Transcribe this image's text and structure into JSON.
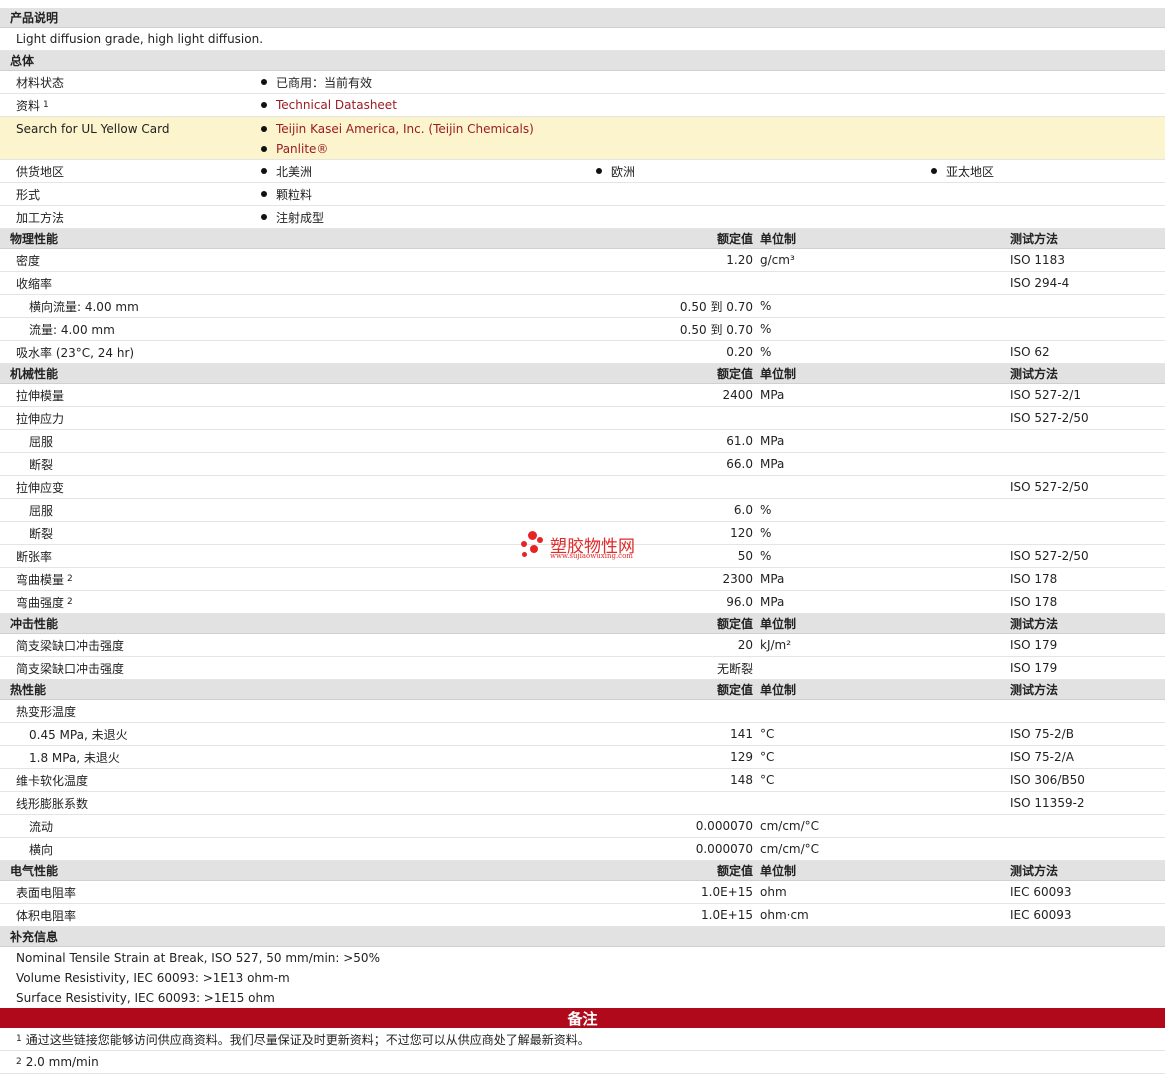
{
  "description": {
    "title": "产品说明",
    "text": "Light diffusion grade, high light diffusion."
  },
  "general": {
    "title": "总体",
    "material_status_label": "材料状态",
    "material_status_value": "已商用：当前有效",
    "info_label": "资料",
    "info_sup": "1",
    "info_value": "Technical Datasheet",
    "yellow_card_label": "Search for UL Yellow Card",
    "yellow_card_links": [
      "Teijin Kasei America, Inc. (Teijin Chemicals)",
      "Panlite®"
    ],
    "regions_label": "供货地区",
    "regions": [
      "北美洲",
      "欧洲",
      "亚太地区"
    ],
    "form_label": "形式",
    "form_value": "颗粒料",
    "processing_label": "加工方法",
    "processing_value": "注射成型"
  },
  "headers": {
    "nominal": "额定值",
    "unit": "单位制",
    "method": "测试方法"
  },
  "physical": {
    "title": "物理性能",
    "rows": [
      {
        "label": "密度",
        "value": "1.20",
        "unit": "g/cm³",
        "method": "ISO 1183"
      },
      {
        "label": "收缩率",
        "value": "",
        "unit": "",
        "method": "ISO 294-4"
      },
      {
        "label": "横向流量: 4.00 mm",
        "value": "0.50 到  0.70",
        "unit": "%",
        "method": ""
      },
      {
        "label": "流量: 4.00 mm",
        "value": "0.50 到  0.70",
        "unit": "%",
        "method": ""
      },
      {
        "label": "吸水率  (23°C, 24 hr)",
        "value": "0.20",
        "unit": "%",
        "method": "ISO 62"
      }
    ]
  },
  "mechanical": {
    "title": "机械性能",
    "rows": [
      {
        "label": "拉伸模量",
        "value": "2400",
        "unit": "MPa",
        "method": "ISO 527-2/1"
      },
      {
        "label": "拉伸应力",
        "value": "",
        "unit": "",
        "method": "ISO 527-2/50"
      },
      {
        "label": "屈服",
        "value": "61.0",
        "unit": "MPa",
        "method": ""
      },
      {
        "label": "断裂",
        "value": "66.0",
        "unit": "MPa",
        "method": ""
      },
      {
        "label": "拉伸应变",
        "value": "",
        "unit": "",
        "method": "ISO 527-2/50"
      },
      {
        "label": "屈服",
        "value": "6.0",
        "unit": "%",
        "method": ""
      },
      {
        "label": "断裂",
        "value": "120",
        "unit": "%",
        "method": ""
      },
      {
        "label": "断张率",
        "value": "50",
        "unit": "%",
        "method": "ISO 527-2/50"
      },
      {
        "label": "弯曲模量",
        "sup": "2",
        "value": "2300",
        "unit": "MPa",
        "method": "ISO 178"
      },
      {
        "label": "弯曲强度",
        "sup": "2",
        "value": "96.0",
        "unit": "MPa",
        "method": "ISO 178"
      }
    ]
  },
  "impact": {
    "title": "冲击性能",
    "rows": [
      {
        "label": "简支梁缺口冲击强度",
        "value": "20",
        "unit": "kJ/m²",
        "method": "ISO 179"
      },
      {
        "label": "简支梁缺口冲击强度",
        "value": "无断裂",
        "unit": "",
        "method": "ISO 179"
      }
    ]
  },
  "thermal": {
    "title": "热性能",
    "rows": [
      {
        "label": "热变形温度",
        "value": "",
        "unit": "",
        "method": ""
      },
      {
        "label": "0.45 MPa, 未退火",
        "value": "141",
        "unit": "°C",
        "method": "ISO 75-2/B"
      },
      {
        "label": "1.8 MPa, 未退火",
        "value": "129",
        "unit": "°C",
        "method": "ISO 75-2/A"
      },
      {
        "label": "维卡软化温度",
        "value": "148",
        "unit": "°C",
        "method": "ISO 306/B50"
      },
      {
        "label": "线形膨胀系数",
        "value": "",
        "unit": "",
        "method": "ISO 11359-2"
      },
      {
        "label": "流动",
        "value": "0.000070",
        "unit": "cm/cm/°C",
        "method": ""
      },
      {
        "label": "横向",
        "value": "0.000070",
        "unit": "cm/cm/°C",
        "method": ""
      }
    ]
  },
  "electrical": {
    "title": "电气性能",
    "rows": [
      {
        "label": "表面电阻率",
        "value": "1.0E+15",
        "unit": "ohm",
        "method": "IEC 60093"
      },
      {
        "label": "体积电阻率",
        "value": "1.0E+15",
        "unit": "ohm·cm",
        "method": "IEC 60093"
      }
    ]
  },
  "supplemental": {
    "title": "补充信息",
    "lines": [
      "Nominal Tensile Strain at Break, ISO 527, 50 mm/min: >50%",
      "Volume Resistivity, IEC 60093: >1E13 ohm-m",
      "Surface Resistivity, IEC 60093: >1E15 ohm"
    ]
  },
  "notes": {
    "title": "备注",
    "items": [
      {
        "sup": "1",
        "text": "通过这些链接您能够访问供应商资料。我们尽量保证及时更新资料；不过您可以从供应商处了解最新资料。"
      },
      {
        "sup": "2",
        "text": "2.0 mm/min"
      }
    ]
  },
  "watermark": {
    "name": "塑胶物性网",
    "url": "www.sujiaowuxing.com",
    "color": "#e02a2a"
  }
}
